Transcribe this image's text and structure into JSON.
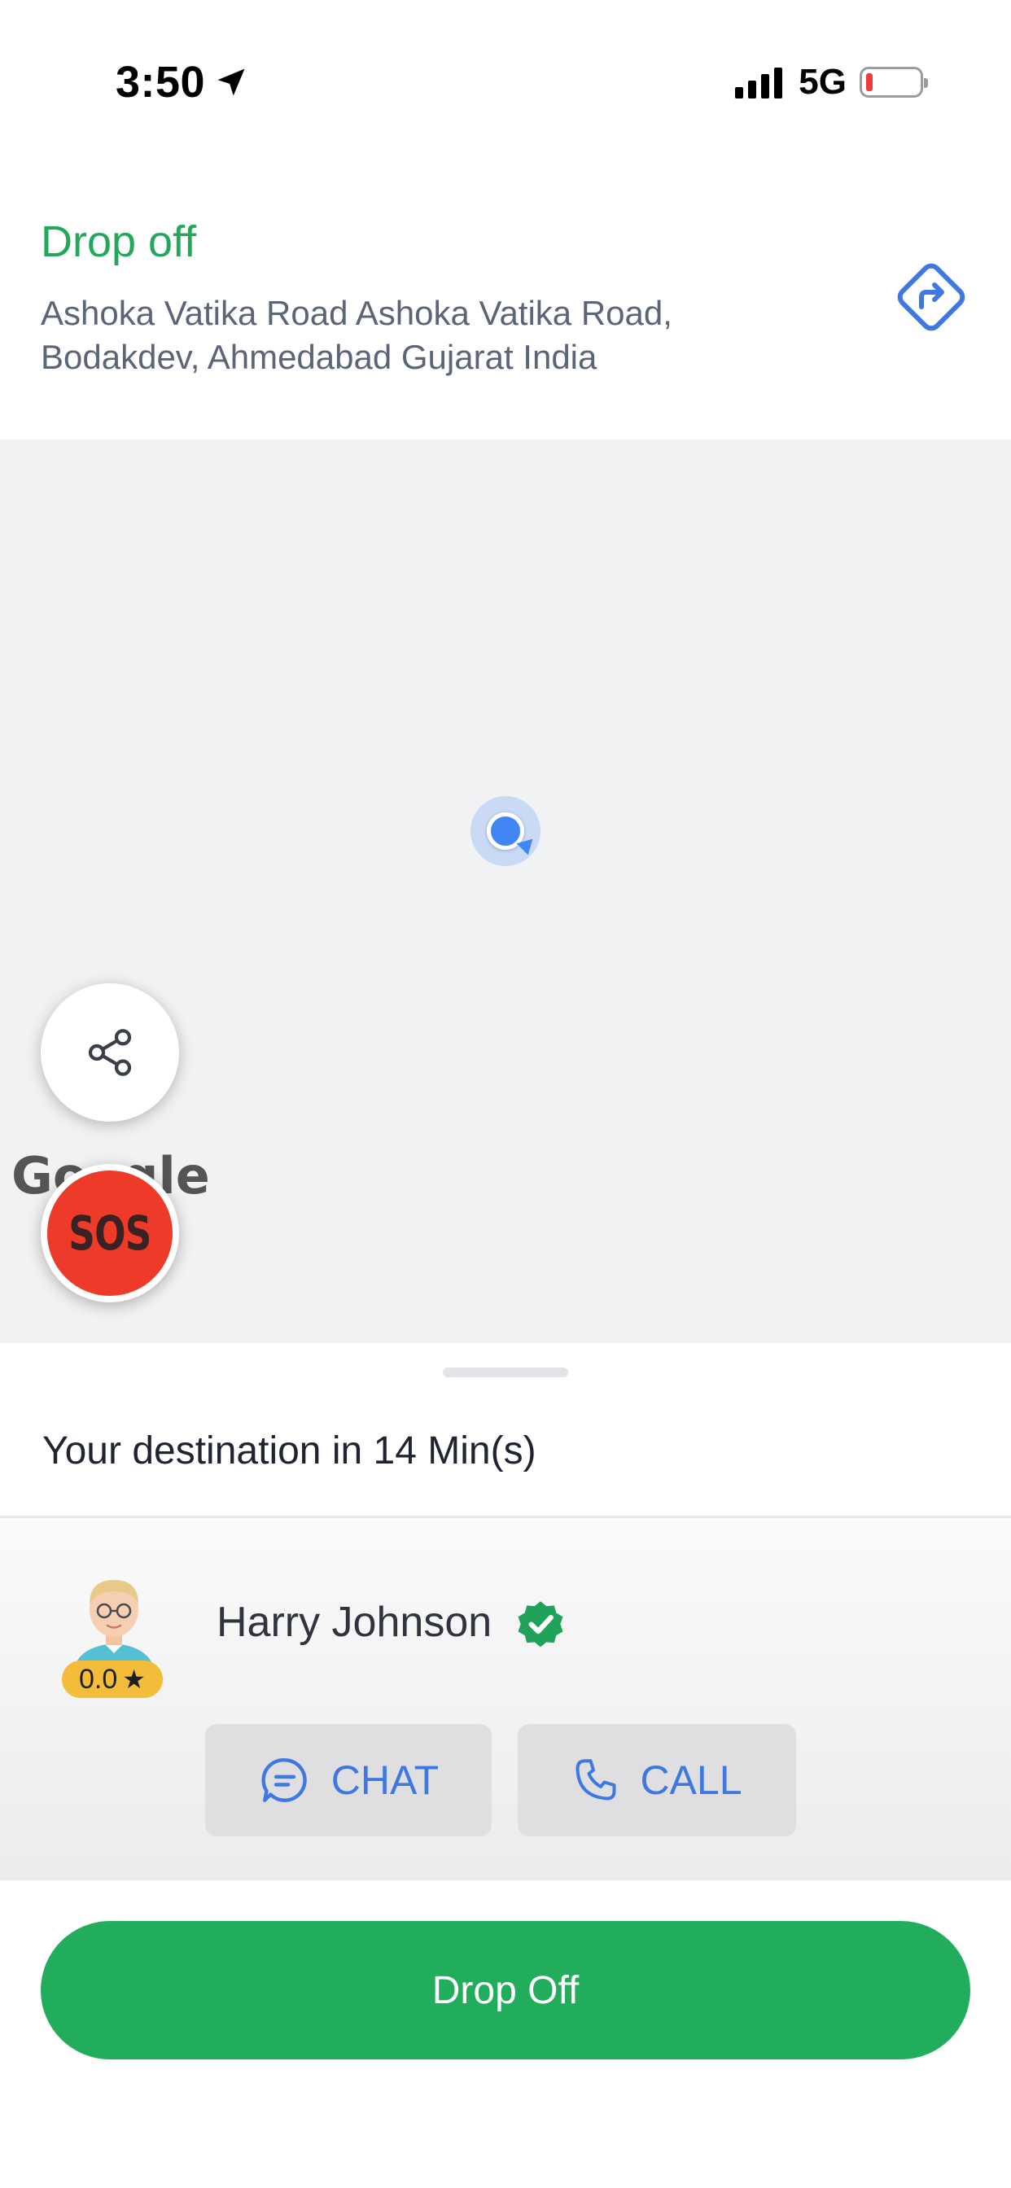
{
  "status_bar": {
    "time": "3:50",
    "network": "5G",
    "signal_bars": 4,
    "battery_level": 0.1
  },
  "header": {
    "title": "Drop off",
    "address": "Ashoka Vatika Road Ashoka Vatika Road, Bodakdev, Ahmedabad Gujarat India",
    "directions_icon": "directions-icon"
  },
  "map": {
    "logo_text": "Google",
    "share_icon": "share-icon",
    "sos_label": "SOS"
  },
  "sheet": {
    "eta_text": "Your destination in 14 Min(s)",
    "driver": {
      "name": "Harry Johnson",
      "rating": "0.0",
      "rating_star": "★"
    },
    "chat_label": "CHAT",
    "call_label": "CALL",
    "primary_action": "Drop Off"
  },
  "colors": {
    "accent_green": "#22ad5c",
    "link_blue": "#3f78e0",
    "sos_red": "#ee3a28",
    "rating_yellow": "#f3bd3a"
  }
}
